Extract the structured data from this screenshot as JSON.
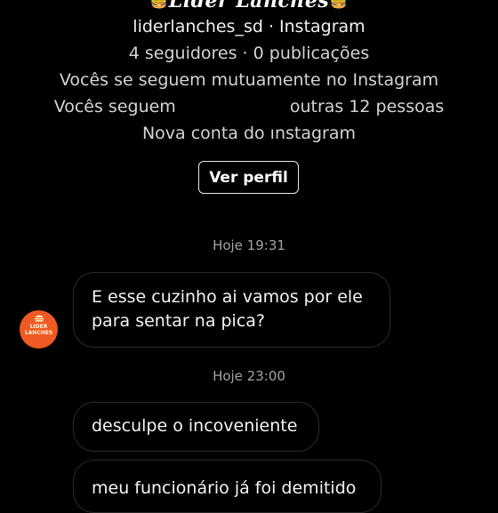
{
  "profile": {
    "display_name": "Lider Lanches",
    "username_line": "liderlanches_sd · Instagram",
    "stats_line": "4 seguidores · 0 publicações",
    "mutual_line": "Vocês se seguem mutuamente no Instagram",
    "following_prefix": "Vocês seguem",
    "following_suffix": "outras 12 pessoas",
    "new_account_line": "Nova conta do ınstagram",
    "view_profile_label": "Ver perfil",
    "name_emoji": "🍔"
  },
  "avatar": {
    "brand_text": "LIDER\nLANCHES",
    "icon": "burger-logo-icon",
    "color": "#ee5a23"
  },
  "thread": {
    "timestamp_1": "Hoje 19:31",
    "timestamp_2": "Hoje 23:00",
    "messages": [
      {
        "line1": "E esse cuzinho ai vamos por ele",
        "line2": "para sentar na pica?"
      },
      {
        "line1": "desculpe o incoveniente"
      },
      {
        "line1": "meu funcionário já foi demitido"
      }
    ]
  }
}
